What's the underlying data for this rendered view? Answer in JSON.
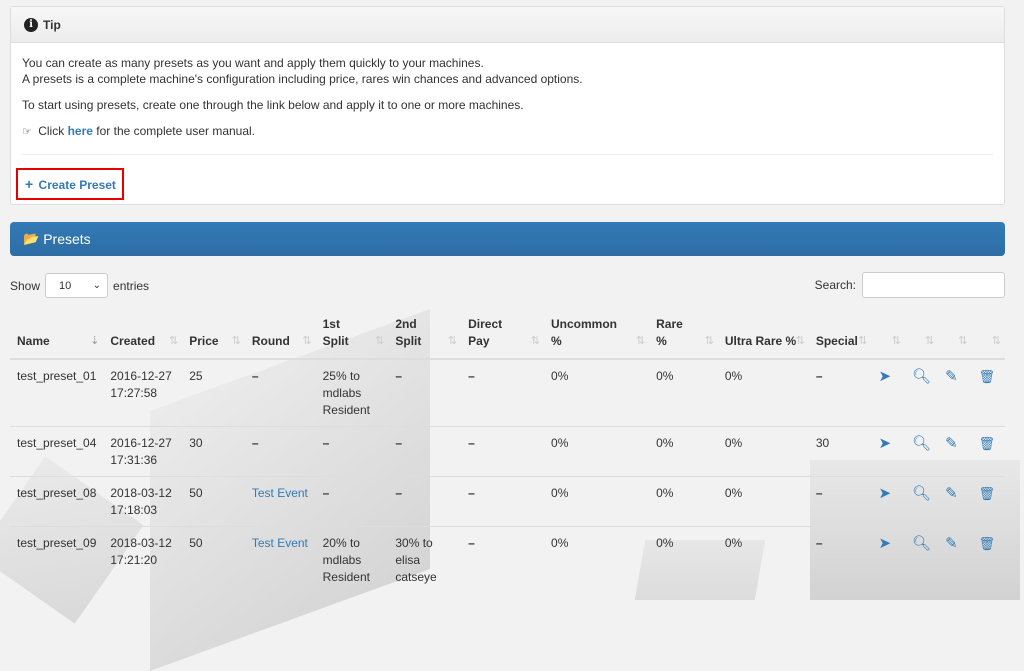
{
  "tip": {
    "title": "Tip",
    "line1": "You can create as many presets as you want and apply them quickly to your machines.",
    "line2": "A presets is a complete machine's configuration including price, rares win chances and advanced options.",
    "line3": "To start using presets, create one through the link below and apply it to one or more machines.",
    "manual_prefix": "Click",
    "manual_link": "here",
    "manual_suffix": "for the complete user manual.",
    "create_label": "Create Preset"
  },
  "presets": {
    "title": "Presets",
    "show_label": "Show",
    "entries_value": "10",
    "entries_label": "entries",
    "search_label": "Search:",
    "search_value": ""
  },
  "table": {
    "headers": [
      "Name",
      "Created",
      "Price",
      "Round",
      "1st Split",
      "2nd Split",
      "Direct Pay",
      "Uncommon %",
      "Rare %",
      "Ultra Rare %",
      "Special",
      "",
      "",
      "",
      ""
    ],
    "rows": [
      {
        "name": "test_preset_01",
        "created_date": "2016-12-27",
        "created_time": "17:27:58",
        "price": "25",
        "round": "–",
        "split1": [
          "25% to",
          "mdlabs",
          "Resident"
        ],
        "split2": "–",
        "direct": "–",
        "uncommon": "0%",
        "rare": "0%",
        "ultra": "0%",
        "special": "–"
      },
      {
        "name": "test_preset_04",
        "created_date": "2016-12-27",
        "created_time": "17:31:36",
        "price": "30",
        "round": "–",
        "split1": "–",
        "split2": "–",
        "direct": "–",
        "uncommon": "0%",
        "rare": "0%",
        "ultra": "0%",
        "special": "30"
      },
      {
        "name": "test_preset_08",
        "created_date": "2018-03-12",
        "created_time": "17:18:03",
        "price": "50",
        "round": "Test Event",
        "split1": "–",
        "split2": "–",
        "direct": "–",
        "uncommon": "0%",
        "rare": "0%",
        "ultra": "0%",
        "special": "–"
      },
      {
        "name": "test_preset_09",
        "created_date": "2018-03-12",
        "created_time": "17:21:20",
        "price": "50",
        "round": "Test Event",
        "split1": [
          "20% to",
          "mdlabs",
          "Resident"
        ],
        "split2": [
          "30% to",
          "elisa",
          "catseye"
        ],
        "direct": "–",
        "uncommon": "0%",
        "rare": "0%",
        "ultra": "0%",
        "special": "–"
      }
    ],
    "actions": [
      "apply-icon",
      "view-icon",
      "edit-icon",
      "delete-icon"
    ]
  }
}
